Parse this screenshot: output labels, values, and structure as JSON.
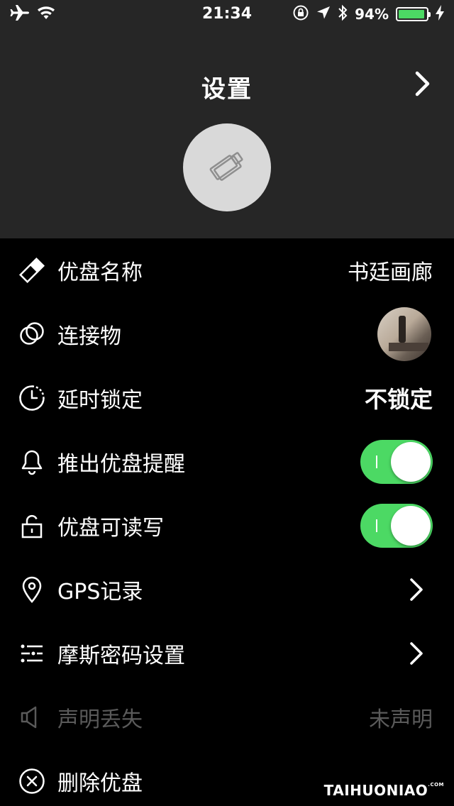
{
  "status_bar": {
    "time": "21:34",
    "battery_pct": "94%",
    "battery_level": 0.94,
    "icons": [
      "airplane-icon",
      "wifi-icon",
      "rotation-lock-icon",
      "location-arrow-icon",
      "bluetooth-icon",
      "battery-icon",
      "charging-icon"
    ]
  },
  "header": {
    "title": "设置",
    "right_icon": "chevron-right-icon",
    "avatar_icon": "usb-drive-icon"
  },
  "rows": [
    {
      "label": "优盘名称",
      "value": "书廷画廊",
      "icon": "tag-icon"
    },
    {
      "label": "连接物",
      "icon": "linked-rings-icon",
      "thumbnail": "connected-object-photo"
    },
    {
      "label": "延时锁定",
      "value": "不锁定",
      "icon": "timer-icon"
    },
    {
      "label": "推出优盘提醒",
      "icon": "bell-icon",
      "toggle_on": true
    },
    {
      "label": "优盘可读写",
      "icon": "unlock-icon",
      "toggle_on": true
    },
    {
      "label": "GPS记录",
      "icon": "location-pin-icon"
    },
    {
      "label": "摩斯密码设置",
      "icon": "sliders-icon"
    },
    {
      "label": "声明丢失",
      "value": "未声明",
      "icon": "speaker-icon",
      "disabled": true
    },
    {
      "label": "删除优盘",
      "icon": "close-circle-icon"
    }
  ],
  "watermark": {
    "text": "TAIHUONIAO",
    "suffix": ".COM"
  },
  "colors": {
    "toggle_on": "#4cd964",
    "header_bg": "#262626",
    "background": "#000000",
    "disabled_text": "#5a5a5a"
  }
}
